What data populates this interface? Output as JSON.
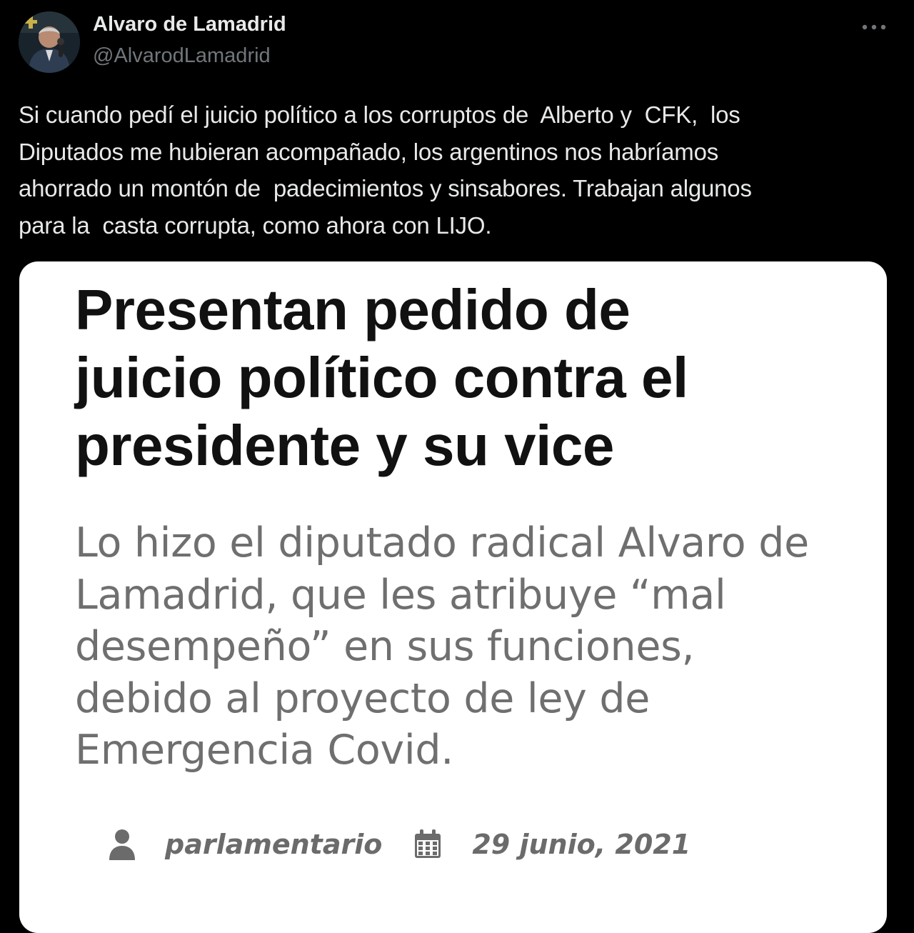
{
  "author": {
    "name": "Alvaro de Lamadrid",
    "handle": "@AlvarodLamadrid"
  },
  "more_icon": "more-horizontal-icon",
  "tweet": {
    "text": "Si cuando pedí el juicio político a los corruptos de  Alberto y  CFK,  los\nDiputados me hubieran acompañado, los argentinos nos habríamos\nahorrado un montón de  padecimientos y sinsabores. Trabajan algunos\npara la  casta corrupta, como ahora con LIJO."
  },
  "media": {
    "article_title": "Presentan pedido de\njuicio político contra el\npresidente y su vice",
    "article_subtitle": "Lo hizo el diputado radical Alvaro de\nLamadrid, que les atribuye “mal\ndesempeño” en sus funciones,\ndebido al proyecto de ley de\nEmergencia Covid.",
    "author_icon": "user-icon",
    "author_label": "parlamentario",
    "date_icon": "calendar-icon",
    "date_label": "29 junio, 2021"
  },
  "colors": {
    "background": "#000000",
    "primary_text": "#e7e9ea",
    "secondary_text": "#71767b",
    "card_background": "#ffffff",
    "headline": "#111111",
    "subtitle": "#6f6f6f",
    "meta": "#6b6b6b"
  }
}
